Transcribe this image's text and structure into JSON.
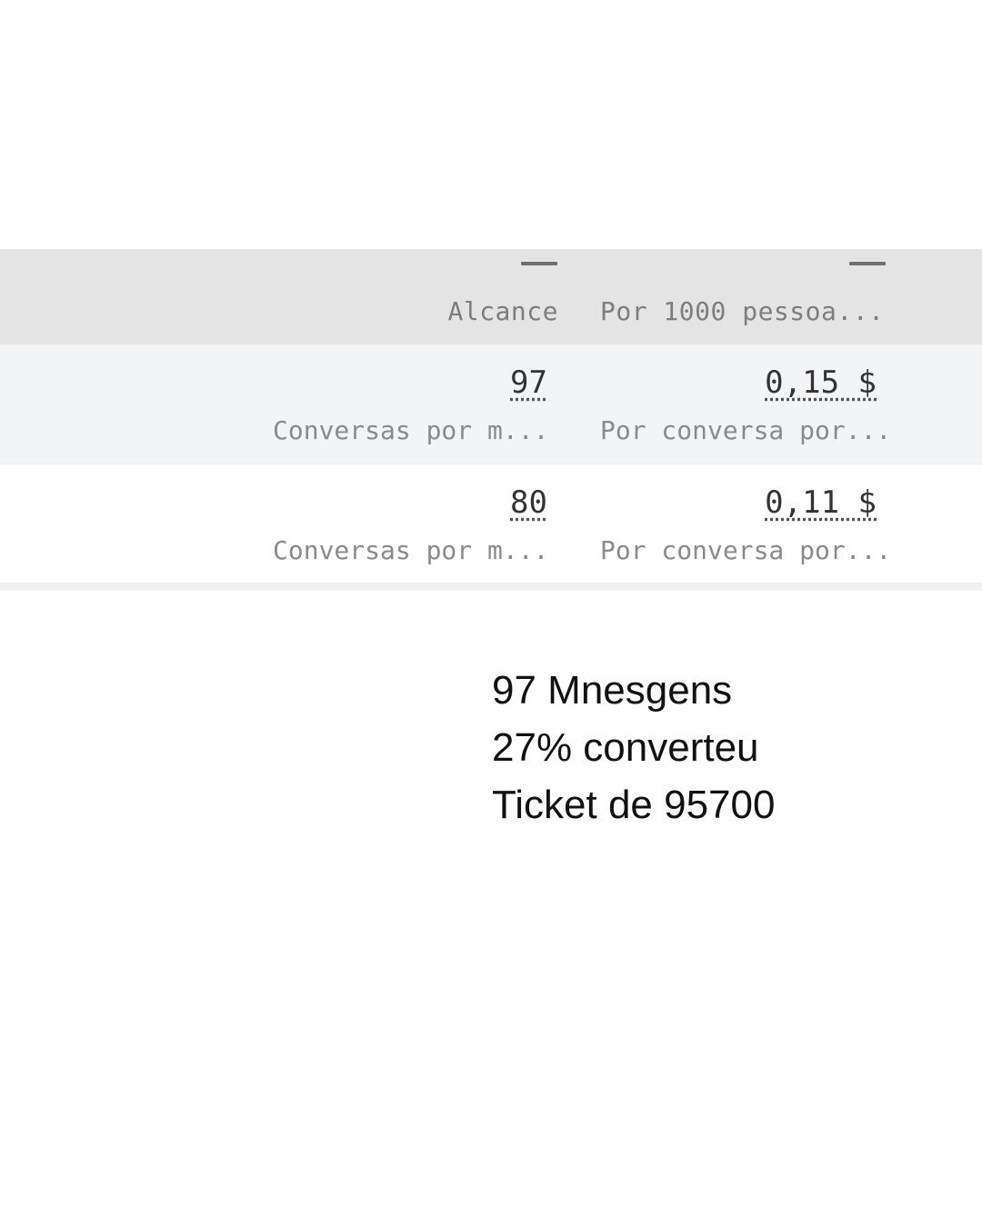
{
  "table": {
    "header": {
      "col1_label": "Alcance",
      "col2_label": "Por 1000 pessoa..."
    },
    "rows": [
      {
        "col1_value": "97",
        "col1_sub": "Conversas por m...",
        "col2_value": "0,15 $",
        "col2_sub": "Por conversa por..."
      },
      {
        "col1_value": "80",
        "col1_sub": "Conversas por m...",
        "col2_value": "0,11 $",
        "col2_sub": "Por conversa por..."
      }
    ]
  },
  "notes": {
    "line1": "97 Mnesgens",
    "line2": "27% converteu",
    "line3": "Ticket de 95700"
  },
  "colors": {
    "header_bg": "#e4e4e4",
    "row_shaded_bg": "#f3f4f5",
    "text_muted": "#8a8a8a",
    "text_value": "#333333"
  }
}
